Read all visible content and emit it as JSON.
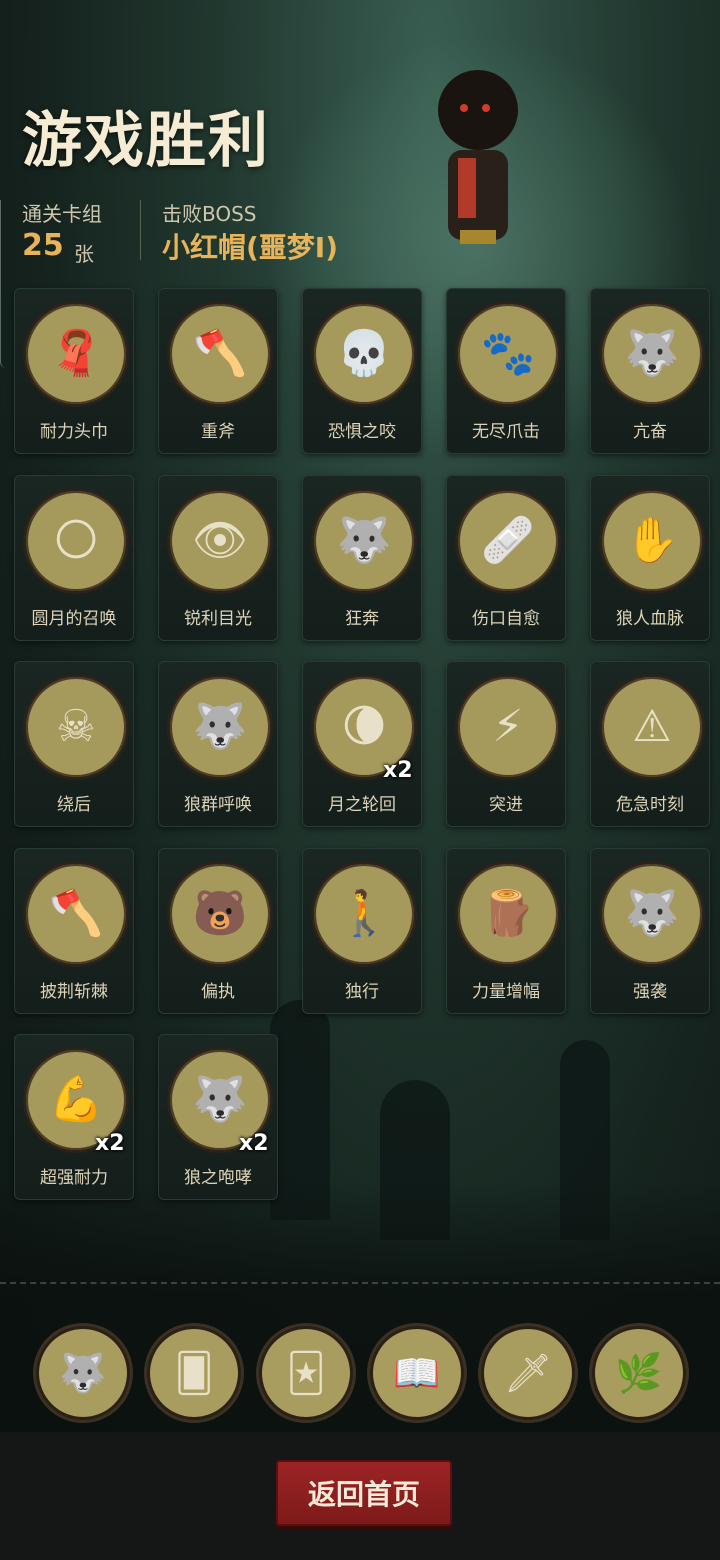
{
  "header": {
    "title": "游戏胜利",
    "deck_label": "通关卡组",
    "deck_count": "25",
    "deck_unit": "张",
    "boss_label": "击败BOSS",
    "boss_name": "小红帽(噩梦I)"
  },
  "cards": [
    {
      "label": "耐力头巾",
      "icon": "bandana-icon",
      "glyph": "🧣",
      "mult": ""
    },
    {
      "label": "重斧",
      "icon": "axe-icon",
      "glyph": "🪓",
      "mult": ""
    },
    {
      "label": "恐惧之咬",
      "icon": "skull-bite-icon",
      "glyph": "💀",
      "mult": ""
    },
    {
      "label": "无尽爪击",
      "icon": "claw-icon",
      "glyph": "🐾",
      "mult": ""
    },
    {
      "label": "亢奋",
      "icon": "werewolf-icon",
      "glyph": "🐺",
      "mult": ""
    },
    {
      "label": "圆月的召唤",
      "icon": "full-moon-icon",
      "glyph": "🌕",
      "mult": ""
    },
    {
      "label": "锐利目光",
      "icon": "wolf-eyes-icon",
      "glyph": "👁",
      "mult": ""
    },
    {
      "label": "狂奔",
      "icon": "running-wolf-icon",
      "glyph": "🐺",
      "mult": ""
    },
    {
      "label": "伤口自愈",
      "icon": "heal-icon",
      "glyph": "🩹",
      "mult": ""
    },
    {
      "label": "狼人血脉",
      "icon": "blood-arm-icon",
      "glyph": "✋",
      "mult": ""
    },
    {
      "label": "绕后",
      "icon": "ambush-icon",
      "glyph": "☠",
      "mult": ""
    },
    {
      "label": "狼群呼唤",
      "icon": "wolf-pack-icon",
      "glyph": "🐺",
      "mult": ""
    },
    {
      "label": "月之轮回",
      "icon": "moon-phases-icon",
      "glyph": "🌘",
      "mult": "x2"
    },
    {
      "label": "突进",
      "icon": "charge-icon",
      "glyph": "⚡",
      "mult": ""
    },
    {
      "label": "危急时刻",
      "icon": "crisis-icon",
      "glyph": "⚠",
      "mult": ""
    },
    {
      "label": "披荆斩棘",
      "icon": "thorn-axe-icon",
      "glyph": "🪓",
      "mult": ""
    },
    {
      "label": "偏执",
      "icon": "wolf-bear-icon",
      "glyph": "🐻",
      "mult": ""
    },
    {
      "label": "独行",
      "icon": "lone-hero-icon",
      "glyph": "🚶",
      "mult": ""
    },
    {
      "label": "力量增幅",
      "icon": "log-carry-icon",
      "glyph": "🪵",
      "mult": ""
    },
    {
      "label": "强袭",
      "icon": "assault-wolf-icon",
      "glyph": "🐺",
      "mult": ""
    },
    {
      "label": "超强耐力",
      "icon": "endurance-icon",
      "glyph": "💪",
      "mult": "x2"
    },
    {
      "label": "狼之咆哮",
      "icon": "wolf-roar-icon",
      "glyph": "🐺",
      "mult": "x2"
    }
  ],
  "bottom_icons": [
    {
      "name": "werewolf-relic-icon",
      "glyph": "🐺"
    },
    {
      "name": "skull-card-icon",
      "glyph": "🂠"
    },
    {
      "name": "card-hand-icon",
      "glyph": "🃏"
    },
    {
      "name": "holy-book-icon",
      "glyph": "📖"
    },
    {
      "name": "sword-card-icon",
      "glyph": "🗡"
    },
    {
      "name": "forest-spirit-icon",
      "glyph": "🌿"
    }
  ],
  "footer": {
    "home_button": "返回首页"
  },
  "colors": {
    "accent_gold": "#e8b45a",
    "button_red": "#9c2424"
  }
}
